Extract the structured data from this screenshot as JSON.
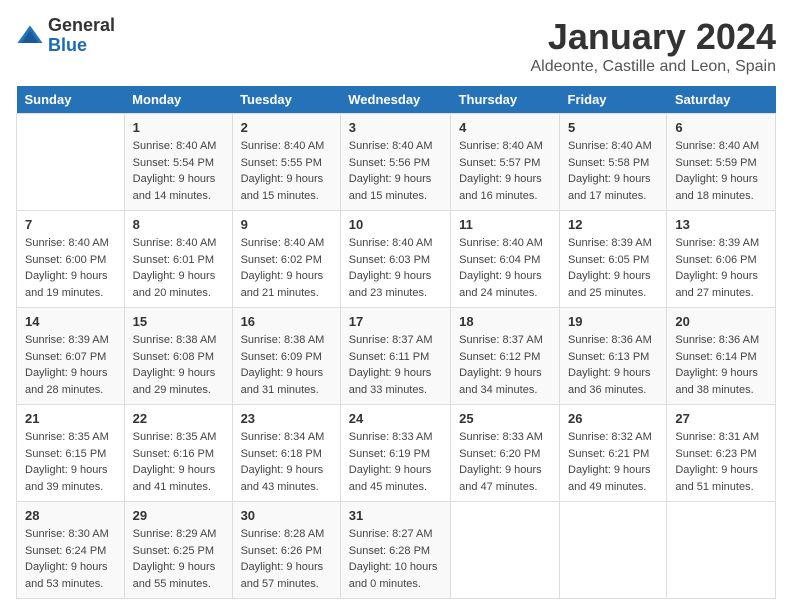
{
  "logo": {
    "general": "General",
    "blue": "Blue"
  },
  "header": {
    "month": "January 2024",
    "location": "Aldeonte, Castille and Leon, Spain"
  },
  "weekdays": [
    "Sunday",
    "Monday",
    "Tuesday",
    "Wednesday",
    "Thursday",
    "Friday",
    "Saturday"
  ],
  "weeks": [
    [
      {
        "day": "",
        "sunrise": "",
        "sunset": "",
        "daylight": ""
      },
      {
        "day": "1",
        "sunrise": "Sunrise: 8:40 AM",
        "sunset": "Sunset: 5:54 PM",
        "daylight": "Daylight: 9 hours and 14 minutes."
      },
      {
        "day": "2",
        "sunrise": "Sunrise: 8:40 AM",
        "sunset": "Sunset: 5:55 PM",
        "daylight": "Daylight: 9 hours and 15 minutes."
      },
      {
        "day": "3",
        "sunrise": "Sunrise: 8:40 AM",
        "sunset": "Sunset: 5:56 PM",
        "daylight": "Daylight: 9 hours and 15 minutes."
      },
      {
        "day": "4",
        "sunrise": "Sunrise: 8:40 AM",
        "sunset": "Sunset: 5:57 PM",
        "daylight": "Daylight: 9 hours and 16 minutes."
      },
      {
        "day": "5",
        "sunrise": "Sunrise: 8:40 AM",
        "sunset": "Sunset: 5:58 PM",
        "daylight": "Daylight: 9 hours and 17 minutes."
      },
      {
        "day": "6",
        "sunrise": "Sunrise: 8:40 AM",
        "sunset": "Sunset: 5:59 PM",
        "daylight": "Daylight: 9 hours and 18 minutes."
      }
    ],
    [
      {
        "day": "7",
        "sunrise": "Sunrise: 8:40 AM",
        "sunset": "Sunset: 6:00 PM",
        "daylight": "Daylight: 9 hours and 19 minutes."
      },
      {
        "day": "8",
        "sunrise": "Sunrise: 8:40 AM",
        "sunset": "Sunset: 6:01 PM",
        "daylight": "Daylight: 9 hours and 20 minutes."
      },
      {
        "day": "9",
        "sunrise": "Sunrise: 8:40 AM",
        "sunset": "Sunset: 6:02 PM",
        "daylight": "Daylight: 9 hours and 21 minutes."
      },
      {
        "day": "10",
        "sunrise": "Sunrise: 8:40 AM",
        "sunset": "Sunset: 6:03 PM",
        "daylight": "Daylight: 9 hours and 23 minutes."
      },
      {
        "day": "11",
        "sunrise": "Sunrise: 8:40 AM",
        "sunset": "Sunset: 6:04 PM",
        "daylight": "Daylight: 9 hours and 24 minutes."
      },
      {
        "day": "12",
        "sunrise": "Sunrise: 8:39 AM",
        "sunset": "Sunset: 6:05 PM",
        "daylight": "Daylight: 9 hours and 25 minutes."
      },
      {
        "day": "13",
        "sunrise": "Sunrise: 8:39 AM",
        "sunset": "Sunset: 6:06 PM",
        "daylight": "Daylight: 9 hours and 27 minutes."
      }
    ],
    [
      {
        "day": "14",
        "sunrise": "Sunrise: 8:39 AM",
        "sunset": "Sunset: 6:07 PM",
        "daylight": "Daylight: 9 hours and 28 minutes."
      },
      {
        "day": "15",
        "sunrise": "Sunrise: 8:38 AM",
        "sunset": "Sunset: 6:08 PM",
        "daylight": "Daylight: 9 hours and 29 minutes."
      },
      {
        "day": "16",
        "sunrise": "Sunrise: 8:38 AM",
        "sunset": "Sunset: 6:09 PM",
        "daylight": "Daylight: 9 hours and 31 minutes."
      },
      {
        "day": "17",
        "sunrise": "Sunrise: 8:37 AM",
        "sunset": "Sunset: 6:11 PM",
        "daylight": "Daylight: 9 hours and 33 minutes."
      },
      {
        "day": "18",
        "sunrise": "Sunrise: 8:37 AM",
        "sunset": "Sunset: 6:12 PM",
        "daylight": "Daylight: 9 hours and 34 minutes."
      },
      {
        "day": "19",
        "sunrise": "Sunrise: 8:36 AM",
        "sunset": "Sunset: 6:13 PM",
        "daylight": "Daylight: 9 hours and 36 minutes."
      },
      {
        "day": "20",
        "sunrise": "Sunrise: 8:36 AM",
        "sunset": "Sunset: 6:14 PM",
        "daylight": "Daylight: 9 hours and 38 minutes."
      }
    ],
    [
      {
        "day": "21",
        "sunrise": "Sunrise: 8:35 AM",
        "sunset": "Sunset: 6:15 PM",
        "daylight": "Daylight: 9 hours and 39 minutes."
      },
      {
        "day": "22",
        "sunrise": "Sunrise: 8:35 AM",
        "sunset": "Sunset: 6:16 PM",
        "daylight": "Daylight: 9 hours and 41 minutes."
      },
      {
        "day": "23",
        "sunrise": "Sunrise: 8:34 AM",
        "sunset": "Sunset: 6:18 PM",
        "daylight": "Daylight: 9 hours and 43 minutes."
      },
      {
        "day": "24",
        "sunrise": "Sunrise: 8:33 AM",
        "sunset": "Sunset: 6:19 PM",
        "daylight": "Daylight: 9 hours and 45 minutes."
      },
      {
        "day": "25",
        "sunrise": "Sunrise: 8:33 AM",
        "sunset": "Sunset: 6:20 PM",
        "daylight": "Daylight: 9 hours and 47 minutes."
      },
      {
        "day": "26",
        "sunrise": "Sunrise: 8:32 AM",
        "sunset": "Sunset: 6:21 PM",
        "daylight": "Daylight: 9 hours and 49 minutes."
      },
      {
        "day": "27",
        "sunrise": "Sunrise: 8:31 AM",
        "sunset": "Sunset: 6:23 PM",
        "daylight": "Daylight: 9 hours and 51 minutes."
      }
    ],
    [
      {
        "day": "28",
        "sunrise": "Sunrise: 8:30 AM",
        "sunset": "Sunset: 6:24 PM",
        "daylight": "Daylight: 9 hours and 53 minutes."
      },
      {
        "day": "29",
        "sunrise": "Sunrise: 8:29 AM",
        "sunset": "Sunset: 6:25 PM",
        "daylight": "Daylight: 9 hours and 55 minutes."
      },
      {
        "day": "30",
        "sunrise": "Sunrise: 8:28 AM",
        "sunset": "Sunset: 6:26 PM",
        "daylight": "Daylight: 9 hours and 57 minutes."
      },
      {
        "day": "31",
        "sunrise": "Sunrise: 8:27 AM",
        "sunset": "Sunset: 6:28 PM",
        "daylight": "Daylight: 10 hours and 0 minutes."
      },
      {
        "day": "",
        "sunrise": "",
        "sunset": "",
        "daylight": ""
      },
      {
        "day": "",
        "sunrise": "",
        "sunset": "",
        "daylight": ""
      },
      {
        "day": "",
        "sunrise": "",
        "sunset": "",
        "daylight": ""
      }
    ]
  ]
}
